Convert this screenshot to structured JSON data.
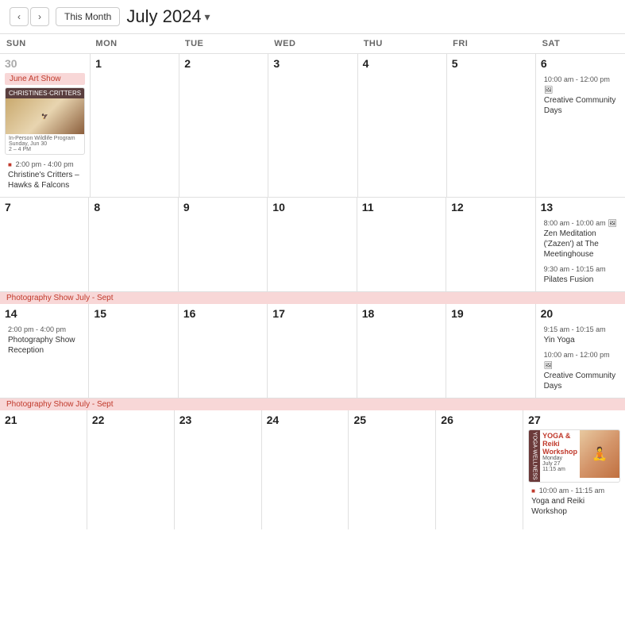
{
  "header": {
    "prev_label": "‹",
    "next_label": "›",
    "this_month_label": "This Month",
    "month_title": "July 2024",
    "caret": "▾"
  },
  "day_headers": [
    "SUN",
    "MON",
    "TUE",
    "WED",
    "THU",
    "FRI",
    "SAT"
  ],
  "weeks": [
    {
      "days": [
        {
          "num": "30",
          "other": true,
          "events": [
            {
              "type": "banner",
              "text": "June Art Show"
            },
            {
              "type": "img-card",
              "time": "2:00 pm - 4:00 pm",
              "title": "Christine's Critters – Hawks & Falcons"
            }
          ]
        },
        {
          "num": "1",
          "events": []
        },
        {
          "num": "2",
          "events": []
        },
        {
          "num": "3",
          "events": []
        },
        {
          "num": "4",
          "events": []
        },
        {
          "num": "5",
          "events": []
        },
        {
          "num": "6",
          "events": [
            {
              "type": "timed",
              "time": "10:00 am - 12:00 pm",
              "icon": true,
              "title": "Creative Community Days"
            }
          ]
        }
      ]
    },
    {
      "days": [
        {
          "num": "7",
          "events": []
        },
        {
          "num": "8",
          "events": []
        },
        {
          "num": "9",
          "events": []
        },
        {
          "num": "10",
          "events": []
        },
        {
          "num": "11",
          "events": []
        },
        {
          "num": "12",
          "events": []
        },
        {
          "num": "13",
          "events": [
            {
              "type": "timed",
              "time": "8:00 am - 10:00 am",
              "icon": true,
              "title": "Zen Meditation ('Zazen') at The Meetinghouse"
            },
            {
              "type": "timed",
              "time": "9:30 am - 10:15 am",
              "title": "Pilates Fusion"
            }
          ]
        }
      ]
    },
    {
      "banner": "Photography Show July - Sept",
      "days": [
        {
          "num": "14",
          "events": [
            {
              "type": "timed",
              "time": "2:00 pm - 4:00 pm",
              "title": "Photography Show Reception"
            }
          ]
        },
        {
          "num": "15",
          "events": []
        },
        {
          "num": "16",
          "events": []
        },
        {
          "num": "17",
          "events": []
        },
        {
          "num": "18",
          "events": []
        },
        {
          "num": "19",
          "events": []
        },
        {
          "num": "20",
          "events": [
            {
              "type": "timed",
              "time": "9:15 am - 10:15 am",
              "title": "Yin Yoga"
            },
            {
              "type": "timed",
              "time": "10:00 am - 12:00 pm",
              "icon": true,
              "title": "Creative Community Days"
            }
          ]
        }
      ]
    },
    {
      "banner": "Photography Show July - Sept",
      "days": [
        {
          "num": "21",
          "events": []
        },
        {
          "num": "22",
          "events": []
        },
        {
          "num": "23",
          "events": []
        },
        {
          "num": "24",
          "events": []
        },
        {
          "num": "25",
          "events": []
        },
        {
          "num": "26",
          "events": []
        },
        {
          "num": "27",
          "events": [
            {
              "type": "yoga-card",
              "time": "10:00 am - 11:15 am",
              "title": "Yoga and Reiki Workshop"
            }
          ]
        }
      ]
    }
  ]
}
